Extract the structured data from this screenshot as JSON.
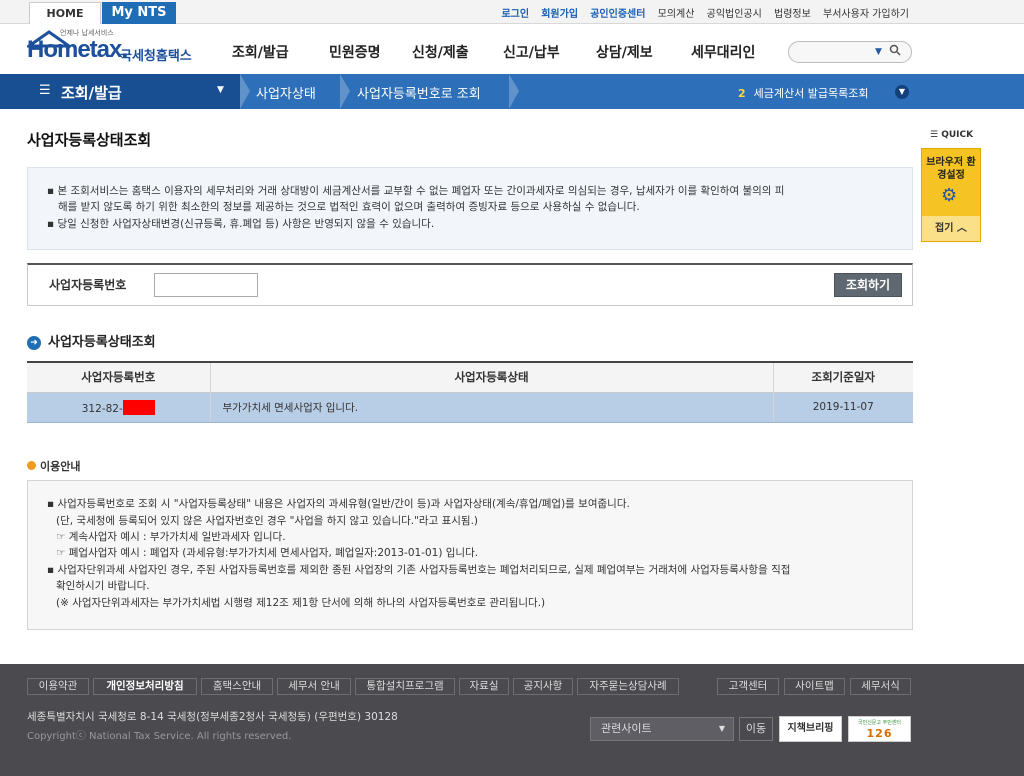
{
  "topbar": {
    "tab_home": "HOME",
    "tab_mynts": "My NTS",
    "links": [
      "로그인",
      "회원가입",
      "공인인증센터",
      "모의계산",
      "공익법인공시",
      "법령정보",
      "부서사용자 가입하기"
    ]
  },
  "header": {
    "logo_text": "Hometax.",
    "logo_sub": "국세청홈택스",
    "logo_tagline": "언제나 납세서비스",
    "gnb": [
      "조회/발급",
      "민원증명",
      "신청/제출",
      "신고/납부",
      "상담/제보",
      "세무대리인"
    ],
    "search_placeholder": ""
  },
  "navbar": {
    "menu_label": "조회/발급",
    "crumbs": [
      "사업자상태",
      "사업자등록번호로 조회"
    ],
    "recent_num": "2",
    "recent_label": "세금계산서 발급목록조회"
  },
  "page": {
    "title": "사업자등록상태조회",
    "notice": [
      "본 조회서비스는 홈택스 이용자의 세무처리와 거래 상대방이 세금계산서를 교부할 수 없는 폐업자 또는 간이과세자로 의심되는 경우, 납세자가 이를 확인하여 불의의 피",
      "해를 받지 않도록 하기 위한 최소한의 정보를 제공하는 것으로 법적인 효력이 없으며 출력하여 증빙자료 등으로 사용하실 수 없습니다.",
      "당일 신청한 사업자상태변경(신규등록, 휴.폐업 등) 사항은 반영되지 않을 수 있습니다."
    ],
    "query_label": "사업자등록번호",
    "query_value": "",
    "search_button": "조회하기",
    "section_title": "사업자등록상태조회",
    "table": {
      "headers": [
        "사업자등록번호",
        "사업자등록상태",
        "조회기준일자"
      ],
      "row": {
        "bizno": "312-82-",
        "status": "부가가치세 면세사업자 입니다.",
        "date": "2019-11-07"
      }
    },
    "guide_title": "이용안내",
    "guide": [
      "사업자등록번호로 조회 시 \"사업자등록상태\" 내용은 사업자의 과세유형(일반/간이 등)과 사업자상태(계속/휴업/폐업)를 보여줍니다.",
      "(단, 국세청에 등록되어 있지 않은 사업자번호인 경우 \"사업을 하지 않고 있습니다.\"라고 표시됨.)",
      "계속사업자 예시 : 부가가치세 일반과세자 입니다.",
      "폐업사업자 예시 : 폐업자 (과세유형:부가가치세 면세사업자, 폐업일자:2013-01-01) 입니다.",
      "사업자단위과세 사업자인 경우, 주된 사업자등록번호를 제외한 종된 사업장의 기존 사업자등록번호는 폐업처리되므로, 실제 폐업여부는 거래처에 사업자등록사항을 직접",
      "확인하시기 바랍니다.",
      "(※ 사업자단위과세자는 부가가치세법 시행령 제12조 제1항 단서에 의해 하나의 사업자등록번호로 관리됩니다.)"
    ]
  },
  "quick": {
    "label": "QUICK",
    "browser_settings": "브라우저 환경설정",
    "close": "접기"
  },
  "footer": {
    "links": [
      "이용약관",
      "개인정보처리방침",
      "홈택스안내",
      "세무서 안내",
      "통합설치프로그램",
      "자료실",
      "공지사항",
      "자주묻는상담사례"
    ],
    "right_links": [
      "고객센터",
      "사이트맵",
      "세무서식"
    ],
    "address": "세종특별자치시 국세청로 8-14 국세청(정부세종2청사 국세청동) (우편번호) 30128",
    "copyright": "Copyrightⓒ National Tax Service. All rights reserved.",
    "related": "관련사이트",
    "go": "이동",
    "banner1": "지책브리핑",
    "banner2_title": "국민신문고 주민센터",
    "banner2_num": "126"
  },
  "colors": {
    "brand_blue": "#2d6fb8",
    "nav_dark": "#174f92",
    "selected_row": "#b8cde6",
    "quick_yellow": "#f6c324",
    "footer_bg": "#4a4a4f"
  }
}
